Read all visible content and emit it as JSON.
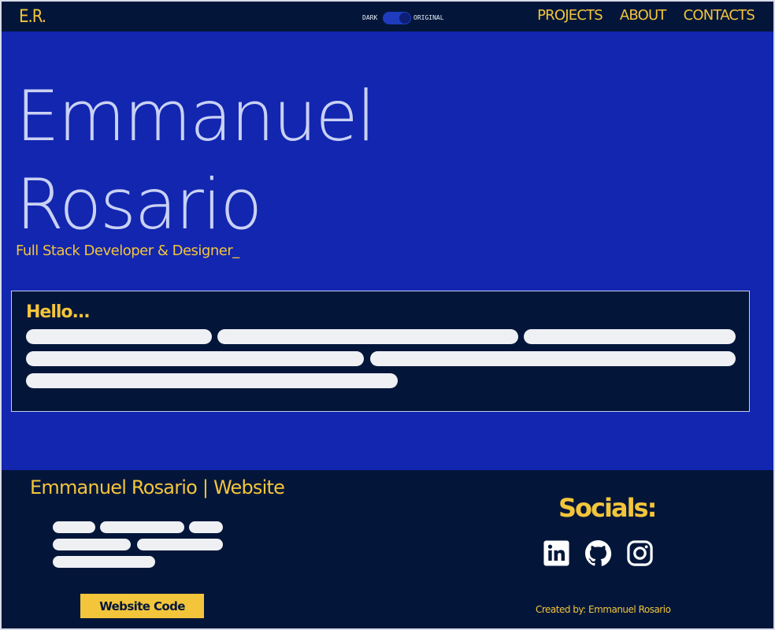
{
  "nav": {
    "logo": "E.R.",
    "toggle": {
      "left_label": "DARK",
      "right_label": "ORIGINAL",
      "state": "original"
    },
    "links": [
      "PROJECTS",
      "ABOUT",
      "CONTACTS"
    ]
  },
  "hero": {
    "name_line1": "Emmanuel",
    "name_line2": "Rosario",
    "subtitle": "Full Stack Developer & Designer_"
  },
  "hello_card": {
    "title": "Hello..."
  },
  "footer": {
    "title": "Emmanuel Rosario | Website",
    "code_button": "Website Code",
    "socials_title": "Socials:",
    "socials": [
      "linkedin-icon",
      "github-icon",
      "instagram-icon"
    ],
    "credit": "Created by: Emmanuel Rosario"
  },
  "colors": {
    "accent": "#f3c53b",
    "navy": "#03163a",
    "hero_blue": "#1226b0",
    "placeholder": "#eef0f4"
  }
}
